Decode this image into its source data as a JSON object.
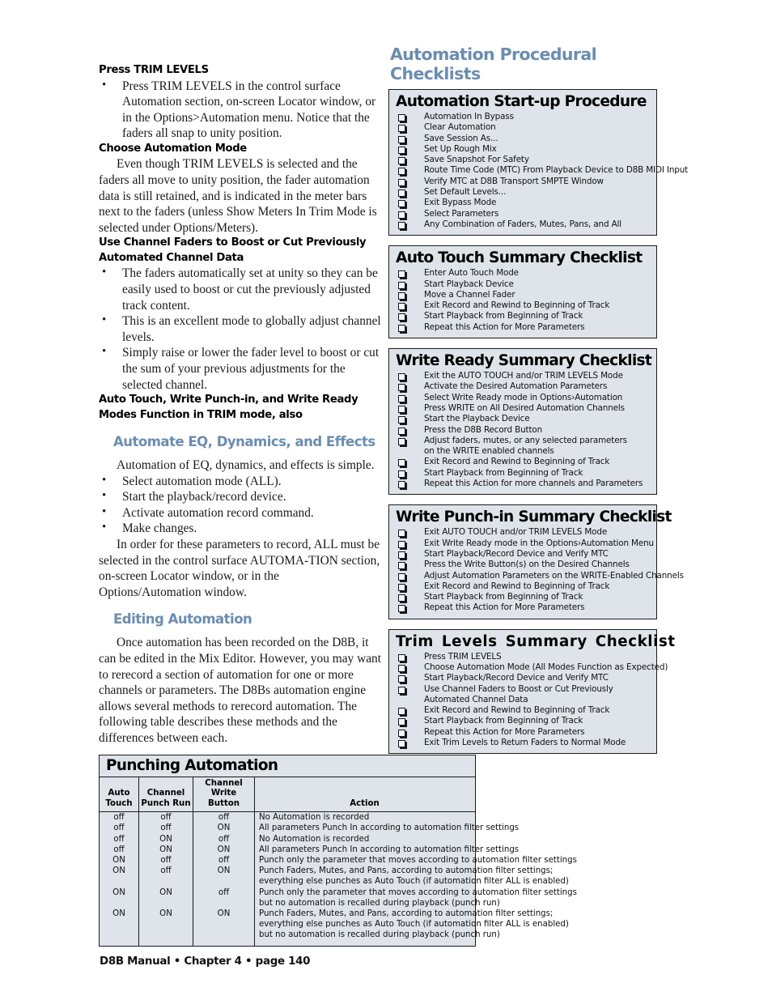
{
  "left_column": {
    "blocks": [
      {
        "kind": "subhead",
        "text": "Press TRIM LEVELS"
      },
      {
        "kind": "bullets",
        "items": [
          "Press TRIM LEVELS  in the control surface Automation section, on-screen Locator window, or in the Options>Automation menu. Notice that the faders all snap to unity position."
        ]
      },
      {
        "kind": "subhead",
        "text": "Choose Automation Mode"
      },
      {
        "kind": "para",
        "indent": true,
        "text": "Even though TRIM LEVELS is selected and the faders all move to unity position, the fader automation data is still retained, and is indicated in the meter bars next to the faders (unless Show Meters In Trim Mode is selected under Options/Meters)."
      },
      {
        "kind": "subhead",
        "text": "Use Channel Faders to Boost or Cut Previously"
      },
      {
        "kind": "subhead",
        "text": "Automated Channel Data"
      },
      {
        "kind": "bullets",
        "items": [
          "The faders automatically set at unity so they can be easily used to boost or cut the previously adjusted track content.",
          "This is an excellent mode to globally adjust channel levels.",
          "Simply raise or lower the fader level to boost or cut the sum of your previous adjustments for the selected channel."
        ]
      },
      {
        "kind": "subhead",
        "text": "Auto Touch, Write Punch-in, and Write Ready"
      },
      {
        "kind": "subhead",
        "text": "Modes Function in TRIM mode, also"
      },
      {
        "kind": "bluehead",
        "text": "Automate EQ, Dynamics, and Effects"
      },
      {
        "kind": "para",
        "indent": true,
        "text": "Automation of EQ, dynamics, and effects is simple."
      },
      {
        "kind": "bullets",
        "items": [
          "Select automation mode (ALL).",
          "Start the playback/record device.",
          "Activate automation record command.",
          "Make changes."
        ]
      },
      {
        "kind": "para",
        "indent": true,
        "text": "In order for these parameters to record, ALL must be selected in the control surface AUTOMA-TION section, on-screen Locator window, or in the Options/Automation window."
      },
      {
        "kind": "bluehead",
        "text": "Editing Automation"
      },
      {
        "kind": "para",
        "indent": true,
        "text": "Once automation has been recorded on the D8B, it can be edited in the Mix Editor. However, you may want to rerecord a section of automation for one or more channels or parameters. The D8Bs automation engine allows several methods to rerecord automation. The following table describes these methods and the differences between each."
      }
    ]
  },
  "right_column": {
    "title": "Automation Procedural Checklists",
    "checklists": [
      {
        "heading": "Automation Start-up Procedure",
        "items": [
          {
            "text": "Automation In Bypass",
            "box": true
          },
          {
            "text": "Clear Automation",
            "box": true
          },
          {
            "text": "Save Session As...",
            "box": true
          },
          {
            "text": "Set Up Rough Mix",
            "box": true
          },
          {
            "text": "Save Snapshot For Safety",
            "box": true
          },
          {
            "text": "Route Time Code (MTC) From Playback Device to D8B MIDI Input",
            "box": true
          },
          {
            "text": "Verify MTC at D8B Transport SMPTE Window",
            "box": true
          },
          {
            "text": "Set Default Levels...",
            "box": true
          },
          {
            "text": "Exit Bypass Mode",
            "box": true
          },
          {
            "text": "Select Parameters",
            "box": true
          },
          {
            "text": "Any Combination of Faders, Mutes, Pans, and All",
            "box": true
          }
        ]
      },
      {
        "heading": "Auto Touch Summary Checklist",
        "items": [
          {
            "text": "Enter Auto Touch Mode",
            "box": true
          },
          {
            "text": "Start Playback Device",
            "box": true
          },
          {
            "text": "Move a Channel Fader",
            "box": true
          },
          {
            "text": "Exit Record and Rewind to Beginning of Track",
            "box": true
          },
          {
            "text": "Start Playback from Beginning of Track",
            "box": true
          },
          {
            "text": "Repeat this Action for More Parameters",
            "box": true
          }
        ]
      },
      {
        "heading": "Write Ready Summary Checklist",
        "items": [
          {
            "text": "Exit the AUTO TOUCH and/or TRIM LEVELS Mode",
            "box": true
          },
          {
            "text": "Activate the Desired Automation Parameters",
            "box": true
          },
          {
            "text": "Select Write Ready mode in Options›Automation",
            "box": true
          },
          {
            "text": "Press WRITE on All Desired Automation Channels",
            "box": true
          },
          {
            "text": "Start the Playback Device",
            "box": true
          },
          {
            "text": "Press the D8B Record Button",
            "box": true
          },
          {
            "text": "Adjust faders, mutes, or any selected parameters",
            "box": true
          },
          {
            "text": "on the WRITE enabled channels",
            "box": false
          },
          {
            "text": "Exit Record and Rewind to Beginning of Track",
            "box": true
          },
          {
            "text": "Start Playback from Beginning of Track",
            "box": true
          },
          {
            "text": "Repeat this Action for more channels and Parameters",
            "box": true
          }
        ]
      },
      {
        "heading": "Write Punch-in Summary Checklist",
        "items": [
          {
            "text": "Exit AUTO TOUCH and/or TRIM LEVELS Mode",
            "box": true
          },
          {
            "text": "Exit Write Ready mode in the Options›Automation Menu",
            "box": true
          },
          {
            "text": "Start Playback/Record Device and Verify MTC",
            "box": true
          },
          {
            "text": "Press the Write Button(s) on the Desired Channels",
            "box": true
          },
          {
            "text": "Adjust Automation Parameters on the WRITE-Enabled Channels",
            "box": true
          },
          {
            "text": "Exit Record and Rewind to Beginning of Track",
            "box": true
          },
          {
            "text": "Start Playback from Beginning of Track",
            "box": true
          },
          {
            "text": "Repeat this Action for More Parameters",
            "box": true
          }
        ]
      },
      {
        "heading": "Trim  Levels  Summary  Checklist",
        "wide": true,
        "items": [
          {
            "text": "Press TRIM LEVELS",
            "box": true
          },
          {
            "text": "Choose Automation Mode (All Modes Function as Expected)",
            "box": true
          },
          {
            "text": "Start Playback/Record Device and Verify MTC",
            "box": true
          },
          {
            "text": "Use Channel Faders to Boost or Cut Previously",
            "box": true
          },
          {
            "text": "Automated Channel Data",
            "box": false
          },
          {
            "text": "Exit Record and Rewind to Beginning of Track",
            "box": true
          },
          {
            "text": "Start Playback from Beginning of Track",
            "box": true
          },
          {
            "text": "Repeat this Action for More Parameters",
            "box": true
          },
          {
            "text": "Exit Trim Levels to Return Faders to Normal Mode",
            "box": true
          }
        ]
      }
    ]
  },
  "punching_table": {
    "title": "Punching Automation",
    "columns": [
      "Auto\nTouch",
      "Channel\nPunch Run",
      "Channel\nWrite Button",
      "Action"
    ],
    "col_headers": [
      {
        "l1": "Auto",
        "l2": "Touch"
      },
      {
        "l1": "Channel",
        "l2": "Punch Run"
      },
      {
        "l1": "Channel",
        "l2": "Write Button"
      },
      {
        "l1": "",
        "l2": "Action"
      }
    ],
    "rows": [
      {
        "auto_touch": "off",
        "punch_run": "off",
        "write_button": "off",
        "action": [
          "No Automation is recorded"
        ]
      },
      {
        "auto_touch": "off",
        "punch_run": "off",
        "write_button": "ON",
        "action": [
          "All parameters Punch In according to automation filter settings"
        ]
      },
      {
        "auto_touch": "off",
        "punch_run": "ON",
        "write_button": "off",
        "action": [
          "No Automation is recorded"
        ]
      },
      {
        "auto_touch": "off",
        "punch_run": "ON",
        "write_button": "ON",
        "action": [
          "All parameters Punch In according to automation filter settings"
        ]
      },
      {
        "auto_touch": "ON",
        "punch_run": "off",
        "write_button": "off",
        "action": [
          "Punch only the parameter that moves according to automation filter settings"
        ]
      },
      {
        "auto_touch": "ON",
        "punch_run": "off",
        "write_button": "ON",
        "action": [
          "Punch Faders, Mutes, and Pans, according to automation filter settings;",
          "everything else punches as Auto Touch (if automation filter ALL is enabled)"
        ]
      },
      {
        "auto_touch": "ON",
        "punch_run": "ON",
        "write_button": "off",
        "action": [
          "Punch only the parameter that moves according to automation filter settings",
          "but no automation is recalled during playback (punch run)"
        ]
      },
      {
        "auto_touch": "ON",
        "punch_run": "ON",
        "write_button": "ON",
        "action": [
          "Punch Faders, Mutes, and Pans, according to automation filter settings;",
          "everything else punches as Auto Touch (if automation filter ALL is enabled)",
          "but no automation is recalled during playback (punch run)"
        ]
      }
    ]
  },
  "footer": {
    "text": "D8B Manual • Chapter 4 • page  140"
  },
  "colors": {
    "accent_blue": "#6b8db0",
    "box_fill": "#dee4e9",
    "box_border": "#1b1b1b",
    "body_text": "#1a1a1a",
    "page_bg": "#ffffff"
  }
}
